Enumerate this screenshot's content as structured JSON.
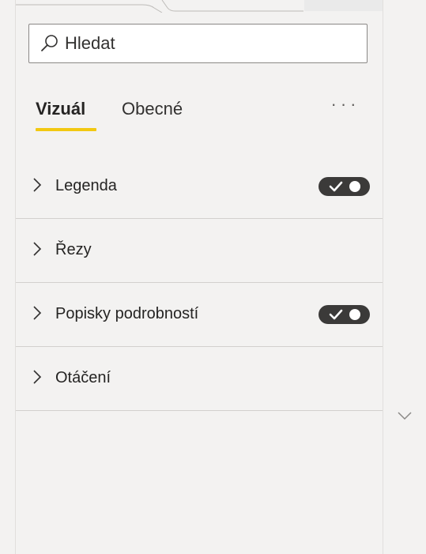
{
  "search": {
    "placeholder": "Hledat"
  },
  "tabs": [
    {
      "label": "Vizuál",
      "active": true
    },
    {
      "label": "Obecné",
      "active": false
    }
  ],
  "more_button": {
    "label": "···"
  },
  "sections": [
    {
      "label": "Legenda",
      "has_toggle": true,
      "toggle_on": true
    },
    {
      "label": "Řezy",
      "has_toggle": false
    },
    {
      "label": "Popisky podrobností",
      "has_toggle": true,
      "toggle_on": true
    },
    {
      "label": "Otáčení",
      "has_toggle": false
    }
  ],
  "colors": {
    "accent_underline": "#f2c811",
    "toggle_on": "#3b3a39",
    "pane_background": "#f3f2f1"
  },
  "icons": {
    "search": "search-icon",
    "expand_chevron": "chevron-right-icon",
    "collapse_chevron": "chevron-down-icon",
    "toggle_check": "checkmark-icon"
  }
}
